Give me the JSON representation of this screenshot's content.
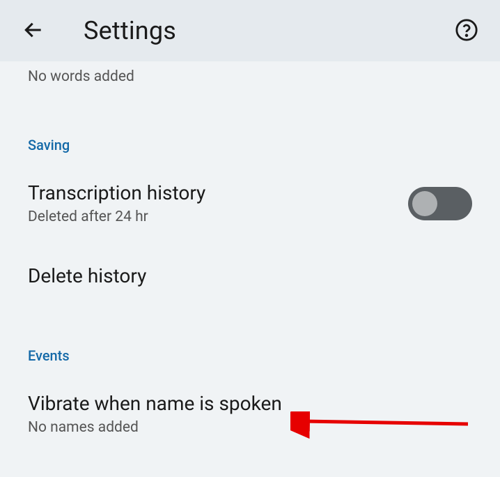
{
  "header": {
    "title": "Settings"
  },
  "top": {
    "no_words": "No words added"
  },
  "saving": {
    "section_label": "Saving",
    "transcription_title": "Transcription history",
    "transcription_sub": "Deleted after 24 hr",
    "delete_history": "Delete history"
  },
  "events": {
    "section_label": "Events",
    "vibrate_title": "Vibrate when name is spoken",
    "vibrate_sub": "No names added"
  }
}
